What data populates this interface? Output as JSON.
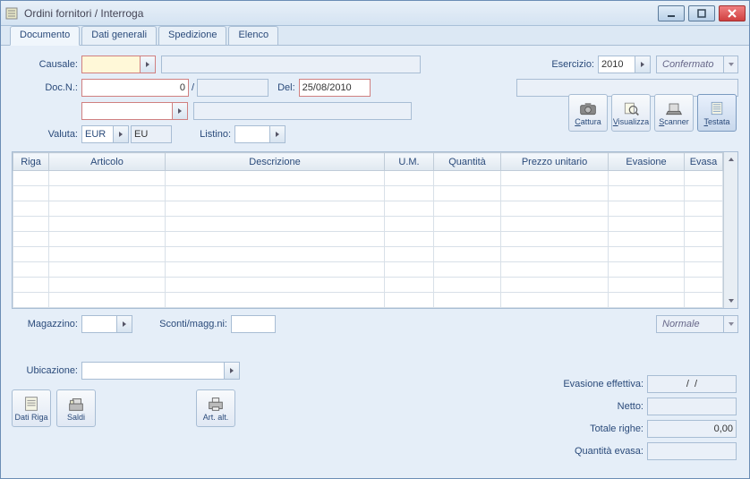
{
  "window": {
    "title": "Ordini fornitori / Interroga"
  },
  "tabs": [
    "Documento",
    "Dati generali",
    "Spedizione",
    "Elenco"
  ],
  "labels": {
    "causale": "Causale:",
    "docn": "Doc.N.:",
    "del": "Del:",
    "esercizio": "Esercizio:",
    "valuta": "Valuta:",
    "listino": "Listino:",
    "magazzino": "Magazzino:",
    "sconti": "Sconti/magg.ni:",
    "ubicazione": "Ubicazione:",
    "evasione": "Evasione effettiva:",
    "netto": "Netto:",
    "totale": "Totale righe:",
    "qevasa": "Quantità evasa:"
  },
  "fields": {
    "causale": "",
    "causale_desc": "",
    "docn": "0",
    "docn2": "",
    "del": "25/08/2010",
    "esercizio": "2010",
    "confermato": "Confermato",
    "esercizio_desc": "",
    "party": "",
    "party_desc": "",
    "valuta": "EUR",
    "valuta2": "EU",
    "listino": "",
    "magazzino": "",
    "sconti": "",
    "ubicazione": "",
    "normale": "Normale",
    "evasione": "/  /",
    "netto": "",
    "totale": "0,00",
    "qevasa": ""
  },
  "toolbar_icons": {
    "cattura": "Cattura",
    "visualizza": "Visualizza",
    "scanner": "Scanner",
    "testata": "Testata"
  },
  "grid_headers": [
    "Riga",
    "Articolo",
    "Descrizione",
    "U.M.",
    "Quantità",
    "Prezzo unitario",
    "Evasione",
    "Evasa"
  ],
  "grid_cols": [
    40,
    130,
    245,
    55,
    75,
    120,
    85,
    50
  ],
  "bottom_icons": {
    "datiriga": "Dati Riga",
    "saldi": "Saldi",
    "artalt": "Art. alt."
  }
}
